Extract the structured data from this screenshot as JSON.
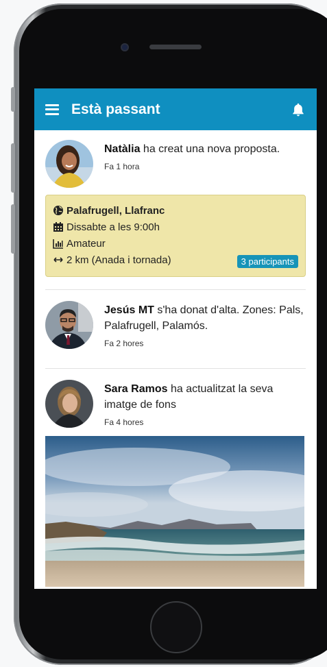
{
  "header": {
    "title": "Està passant"
  },
  "feed": [
    {
      "name": "Natàlia",
      "text": " ha creat una nova proposta.",
      "time": "Fa 1 hora"
    },
    {
      "name": "Jesús MT",
      "text": " s'ha donat d'alta. Zones: Pals, Palafrugell, Palamós.",
      "time": "Fa 2 hores"
    },
    {
      "name": "Sara Ramos",
      "text": " ha actualitzat la seva imatge de fons",
      "time": "Fa 4 hores"
    }
  ],
  "proposal": {
    "location": "Palafrugell, Llafranc",
    "date": "Dissabte a les 9:00h",
    "level": "Amateur",
    "distance": "2 km (Anada i tornada)",
    "participants": "3 participants"
  },
  "colors": {
    "accent": "#0f8fc0",
    "card": "#efe6a9",
    "badge": "#1794b8"
  },
  "icons": [
    "menu-icon",
    "bell-icon",
    "globe-icon",
    "calendar-icon",
    "chart-icon",
    "arrows-icon"
  ]
}
